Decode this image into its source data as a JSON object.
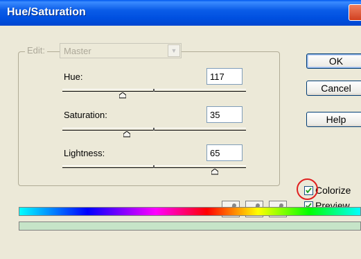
{
  "window": {
    "title": "Hue/Saturation"
  },
  "edit": {
    "label": "Edit:",
    "selected": "Master"
  },
  "sliders": [
    {
      "label": "Hue:",
      "value": "117",
      "level": 0.33
    },
    {
      "label": "Saturation:",
      "value": "35",
      "level": 0.35
    },
    {
      "label": "Lightness:",
      "value": "65",
      "level": 0.83
    }
  ],
  "buttons": {
    "ok": "OK",
    "cancel": "Cancel",
    "help": "Help"
  },
  "checks": {
    "colorize": {
      "label": "Colorize",
      "checked": true
    },
    "preview": {
      "label": "Preview",
      "checked": true
    }
  },
  "icons": [
    "eyedropper-icon",
    "eyedropper-plus-icon",
    "eyedropper-minus-icon"
  ],
  "colors": {
    "titlebar": "#0a5ce8",
    "highlight": "#e02020",
    "result": "#c6e4c8"
  }
}
